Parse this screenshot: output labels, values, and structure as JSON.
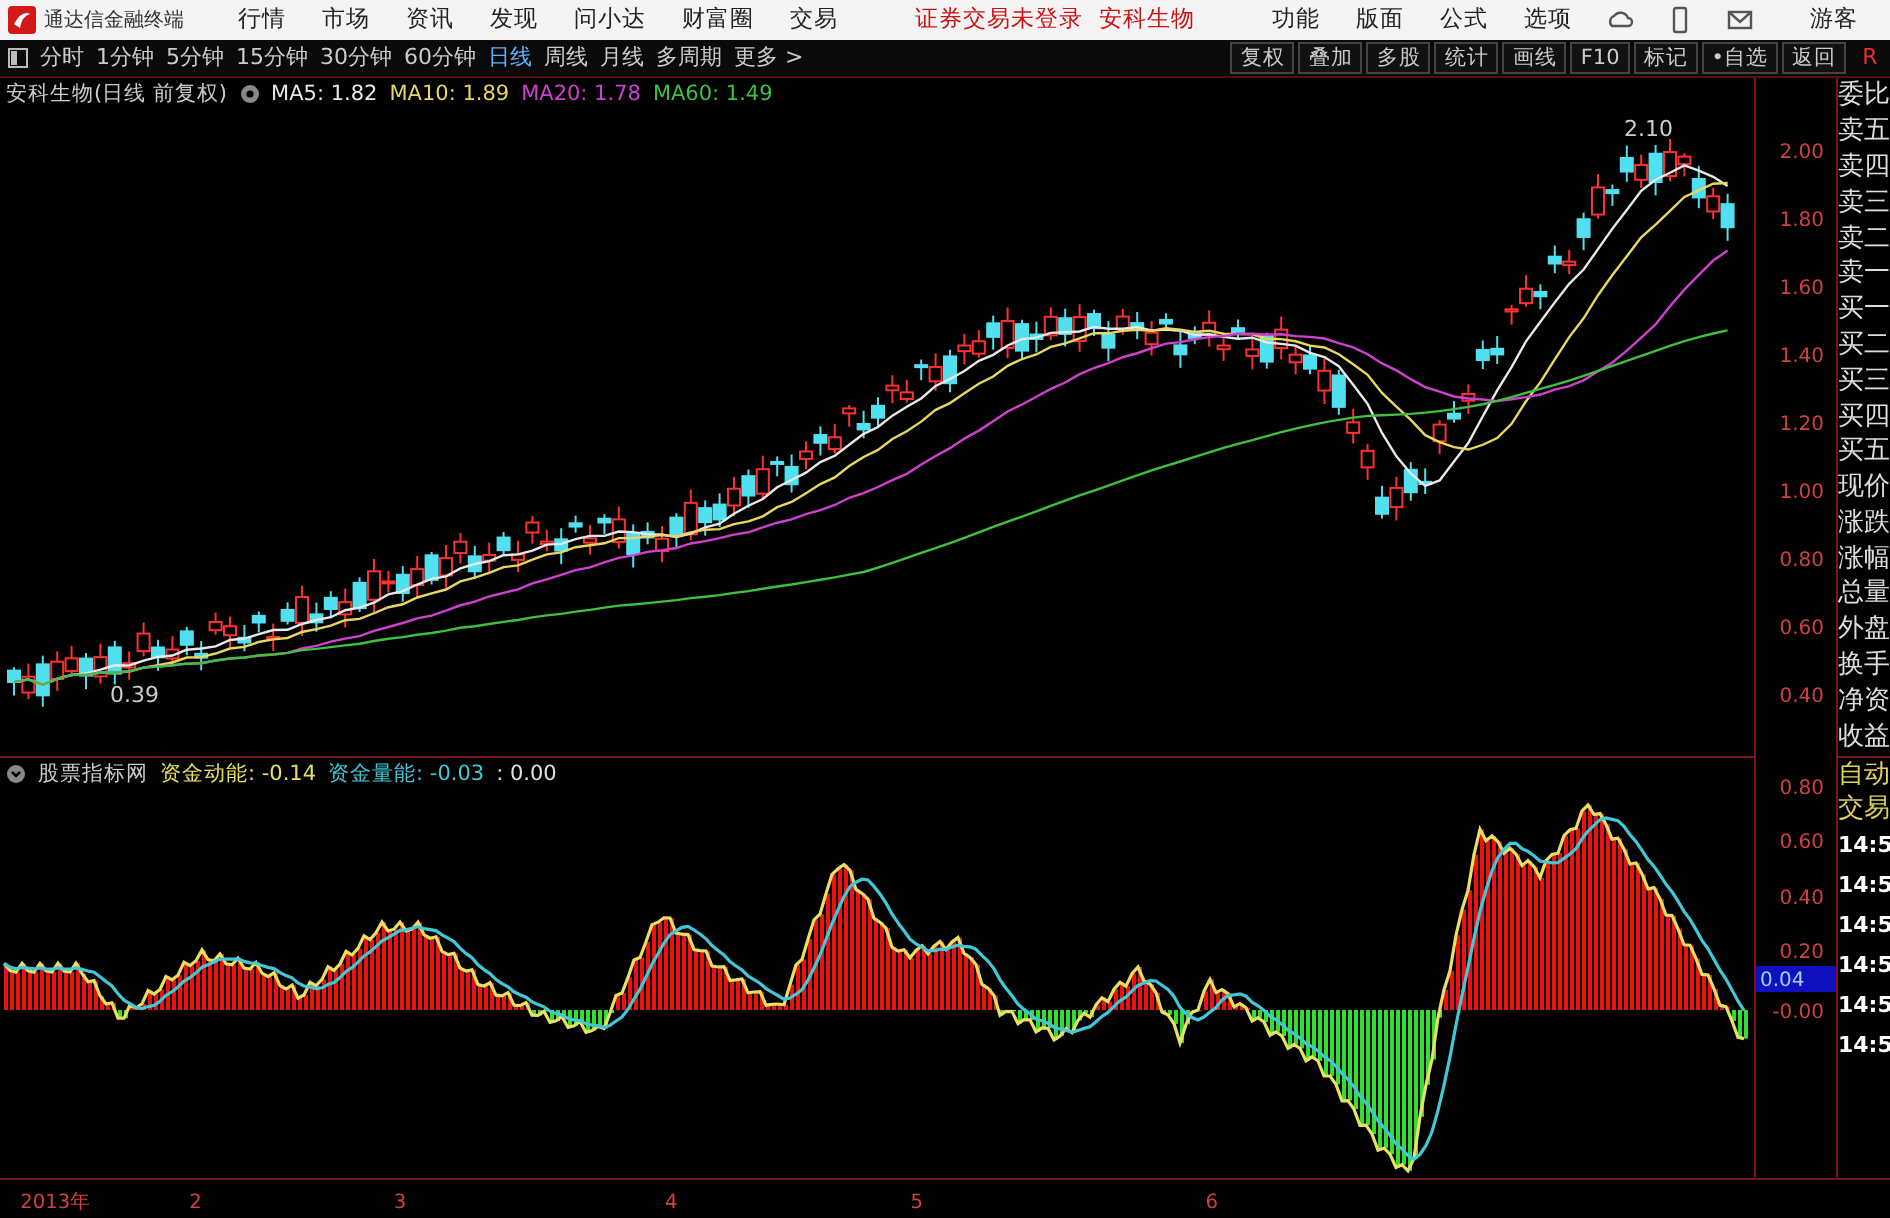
{
  "app_bar": {
    "title": "通达信金融终端",
    "menu": [
      "行情",
      "市场",
      "资讯",
      "发现",
      "问小达",
      "财富圈",
      "交易"
    ],
    "notices": [
      "证券交易未登录",
      "安科生物"
    ],
    "tools": [
      "功能",
      "版面",
      "公式",
      "选项"
    ],
    "user": "游客"
  },
  "period_bar": {
    "periods": [
      {
        "label": "分时",
        "selected": false
      },
      {
        "label": "1分钟",
        "selected": false
      },
      {
        "label": "5分钟",
        "selected": false
      },
      {
        "label": "15分钟",
        "selected": false
      },
      {
        "label": "30分钟",
        "selected": false
      },
      {
        "label": "60分钟",
        "selected": false
      },
      {
        "label": "日线",
        "selected": true
      },
      {
        "label": "周线",
        "selected": false
      },
      {
        "label": "月线",
        "selected": false
      },
      {
        "label": "多周期",
        "selected": false
      }
    ],
    "more": "更多 >",
    "actions": [
      "复权",
      "叠加",
      "多股",
      "统计",
      "画线",
      "F10",
      "标记",
      "•自选",
      "返回"
    ],
    "corner": "R"
  },
  "price_chart": {
    "title": "安科生物(日线 前复权)",
    "ma": [
      {
        "label": "MA5: 1.82",
        "color": "#e8e8e8"
      },
      {
        "label": "MA10: 1.89",
        "color": "#e8d860"
      },
      {
        "label": "MA20: 1.78",
        "color": "#d040d0"
      },
      {
        "label": "MA60: 1.49",
        "color": "#40c040"
      }
    ],
    "y_ticks": [
      "2.00",
      "1.80",
      "1.60",
      "1.40",
      "1.20",
      "1.00",
      "0.80",
      "0.60",
      "0.40"
    ],
    "high_label": "2.10",
    "low_label": "0.39"
  },
  "indicator": {
    "name": "股票指标网",
    "lines": [
      {
        "label": "资金动能: -0.14",
        "color": "#e8e060"
      },
      {
        "label": "资金量能: -0.03",
        "color": "#40c8d8"
      },
      {
        "label": ": 0.00",
        "color": "#e0e0e0"
      }
    ],
    "y_ticks": [
      "0.80",
      "0.60",
      "0.40",
      "0.20",
      "-0.00"
    ],
    "current": "0.04"
  },
  "date_axis": [
    "2013年",
    "2",
    "3",
    "4",
    "5",
    "6"
  ],
  "quote_panel": {
    "fields": [
      "委比",
      "卖五",
      "卖四",
      "卖三",
      "卖二",
      "卖一",
      "买一",
      "买二",
      "买三",
      "买四",
      "买五",
      "现价",
      "涨跌",
      "涨幅",
      "总量",
      "外盘",
      "换手",
      "净资",
      "收益"
    ],
    "trade": [
      "自动",
      "交易"
    ],
    "times": [
      "14:5",
      "14:5",
      "14:5",
      "14:5",
      "14:5",
      "14:5"
    ]
  }
}
